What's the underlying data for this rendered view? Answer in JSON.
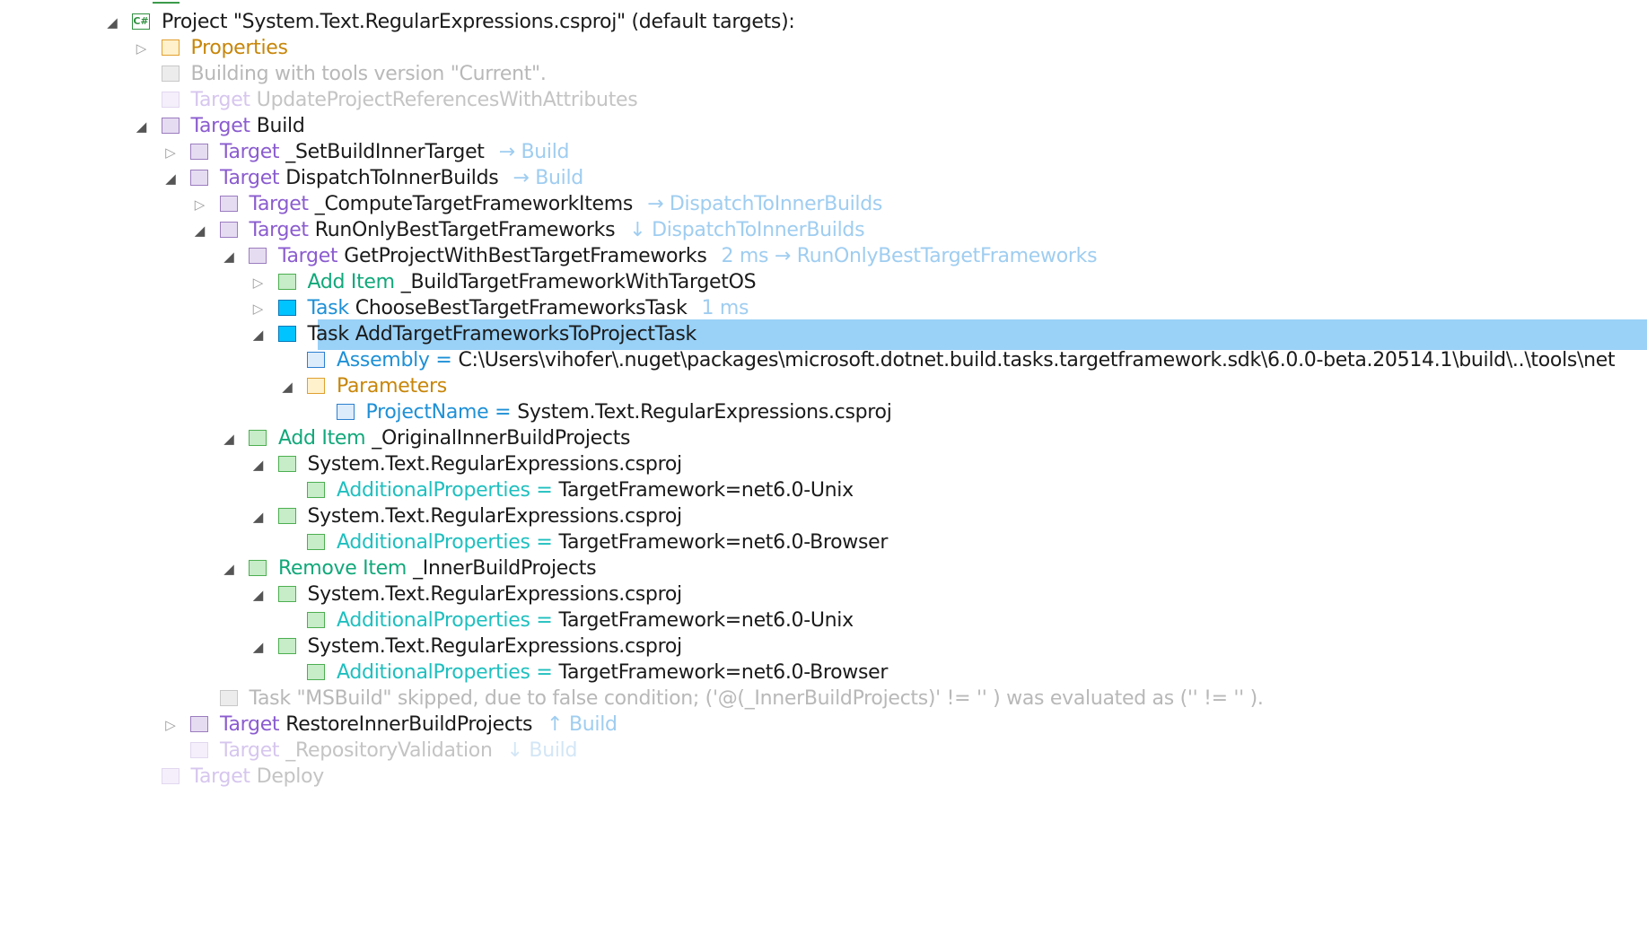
{
  "tree": {
    "rows": [
      {
        "depth": 0,
        "arrow": "expanded",
        "icon": "csharp-project",
        "keyword": "",
        "name": "Project \"System.Text.RegularExpressions.csproj\" (default targets):",
        "suffix": "",
        "style": "normal"
      },
      {
        "depth": 1,
        "arrow": "collapsed",
        "icon": "folder",
        "keyword": "Properties",
        "name": "",
        "suffix": "",
        "style": "folder"
      },
      {
        "depth": 1,
        "arrow": "none",
        "icon": "message",
        "keyword": "",
        "name": "Building with tools version \"Current\".",
        "suffix": "",
        "style": "dim"
      },
      {
        "depth": 1,
        "arrow": "none",
        "icon": "target",
        "keyword": "Target",
        "name": "UpdateProjectReferencesWithAttributes",
        "suffix": "",
        "style": "dim-target"
      },
      {
        "depth": 1,
        "arrow": "expanded",
        "icon": "target",
        "keyword": "Target",
        "name": "Build",
        "suffix": "",
        "style": "target"
      },
      {
        "depth": 2,
        "arrow": "collapsed",
        "icon": "target",
        "keyword": "Target",
        "name": "_SetBuildInnerTarget",
        "suffix": "→ Build",
        "style": "target"
      },
      {
        "depth": 2,
        "arrow": "expanded",
        "icon": "target",
        "keyword": "Target",
        "name": "DispatchToInnerBuilds",
        "suffix": "→ Build",
        "style": "target"
      },
      {
        "depth": 3,
        "arrow": "collapsed",
        "icon": "target",
        "keyword": "Target",
        "name": "_ComputeTargetFrameworkItems",
        "suffix": "→ DispatchToInnerBuilds",
        "style": "target"
      },
      {
        "depth": 3,
        "arrow": "expanded",
        "icon": "target",
        "keyword": "Target",
        "name": "RunOnlyBestTargetFrameworks",
        "suffix": "↓ DispatchToInnerBuilds",
        "style": "target"
      },
      {
        "depth": 4,
        "arrow": "expanded",
        "icon": "target",
        "keyword": "Target",
        "name": "GetProjectWithBestTargetFrameworks",
        "suffix": "2 ms → RunOnlyBestTargetFrameworks",
        "style": "target"
      },
      {
        "depth": 5,
        "arrow": "collapsed",
        "icon": "item",
        "keyword": "Add Item",
        "name": "_BuildTargetFrameworkWithTargetOS",
        "suffix": "",
        "style": "item"
      },
      {
        "depth": 5,
        "arrow": "collapsed",
        "icon": "task",
        "keyword": "Task",
        "name": "ChooseBestTargetFrameworksTask",
        "suffix": "1 ms",
        "style": "task"
      },
      {
        "depth": 5,
        "arrow": "expanded",
        "icon": "task",
        "keyword": "Task",
        "name": "AddTargetFrameworksToProjectTask",
        "suffix": "",
        "style": "task-selected",
        "selected": true
      },
      {
        "depth": 6,
        "arrow": "none",
        "icon": "property",
        "keyword": "Assembly =",
        "name": "C:\\Users\\vihofer\\.nuget\\packages\\microsoft.dotnet.build.tasks.targetframework.sdk\\6.0.0-beta.20514.1\\build\\..\\tools\\net",
        "suffix": "",
        "style": "property"
      },
      {
        "depth": 6,
        "arrow": "expanded",
        "icon": "folder",
        "keyword": "Parameters",
        "name": "",
        "suffix": "",
        "style": "folder"
      },
      {
        "depth": 7,
        "arrow": "none",
        "icon": "property",
        "keyword": "ProjectName =",
        "name": "System.Text.RegularExpressions.csproj",
        "suffix": "",
        "style": "property"
      },
      {
        "depth": 4,
        "arrow": "expanded",
        "icon": "item",
        "keyword": "Add Item",
        "name": "_OriginalInnerBuildProjects",
        "suffix": "",
        "style": "item"
      },
      {
        "depth": 5,
        "arrow": "expanded",
        "icon": "item",
        "keyword": "",
        "name": "System.Text.RegularExpressions.csproj",
        "suffix": "",
        "style": "normal"
      },
      {
        "depth": 6,
        "arrow": "none",
        "icon": "item",
        "keyword": "AdditionalProperties =",
        "name": "TargetFramework=net6.0-Unix",
        "suffix": "",
        "style": "meta"
      },
      {
        "depth": 5,
        "arrow": "expanded",
        "icon": "item",
        "keyword": "",
        "name": "System.Text.RegularExpressions.csproj",
        "suffix": "",
        "style": "normal"
      },
      {
        "depth": 6,
        "arrow": "none",
        "icon": "item",
        "keyword": "AdditionalProperties =",
        "name": "TargetFramework=net6.0-Browser",
        "suffix": "",
        "style": "meta"
      },
      {
        "depth": 4,
        "arrow": "expanded",
        "icon": "item",
        "keyword": "Remove Item",
        "name": "_InnerBuildProjects",
        "suffix": "",
        "style": "item"
      },
      {
        "depth": 5,
        "arrow": "expanded",
        "icon": "item",
        "keyword": "",
        "name": "System.Text.RegularExpressions.csproj",
        "suffix": "",
        "style": "normal"
      },
      {
        "depth": 6,
        "arrow": "none",
        "icon": "item",
        "keyword": "AdditionalProperties =",
        "name": "TargetFramework=net6.0-Unix",
        "suffix": "",
        "style": "meta"
      },
      {
        "depth": 5,
        "arrow": "expanded",
        "icon": "item",
        "keyword": "",
        "name": "System.Text.RegularExpressions.csproj",
        "suffix": "",
        "style": "normal"
      },
      {
        "depth": 6,
        "arrow": "none",
        "icon": "item",
        "keyword": "AdditionalProperties =",
        "name": "TargetFramework=net6.0-Browser",
        "suffix": "",
        "style": "meta"
      },
      {
        "depth": 3,
        "arrow": "none",
        "icon": "message",
        "keyword": "",
        "name": "Task \"MSBuild\" skipped, due to false condition; ('@(_InnerBuildProjects)' != '' ) was evaluated as ('' != '' ).",
        "suffix": "",
        "style": "dim"
      },
      {
        "depth": 2,
        "arrow": "collapsed",
        "icon": "target",
        "keyword": "Target",
        "name": "RestoreInnerBuildProjects",
        "suffix": "↑ Build",
        "style": "target"
      },
      {
        "depth": 2,
        "arrow": "none",
        "icon": "target",
        "keyword": "Target",
        "name": "_RepositoryValidation",
        "suffix": "↓ Build",
        "style": "dim-target"
      },
      {
        "depth": 1,
        "arrow": "none",
        "icon": "target",
        "keyword": "Target",
        "name": "Deploy",
        "suffix": "",
        "style": "dim-target"
      }
    ]
  },
  "colors": {
    "target_keyword": "#8b5ccf",
    "target_icon_fill": "#e6dcf2",
    "target_icon_border": "#9b7cbf",
    "item_keyword": "#11a879",
    "item_icon_fill": "#c7ecc8",
    "item_icon_border": "#4caf50",
    "task_keyword": "#1e90d6",
    "task_icon_fill": "#00c4ff",
    "task_icon_border": "#0078b8",
    "property_keyword": "#1e90d6",
    "property_icon_fill": "#dcecfb",
    "property_icon_border": "#2b7fd0",
    "folder_keyword": "#c7860a",
    "folder_icon_fill": "#fff1cc",
    "folder_icon_border": "#e0a030",
    "meta_keyword": "#1fbfbf",
    "message_icon_fill": "#ececec",
    "message_icon_border": "#c8c8c8",
    "suffix": "#9fcdf0",
    "selection": "#99d1f7"
  }
}
